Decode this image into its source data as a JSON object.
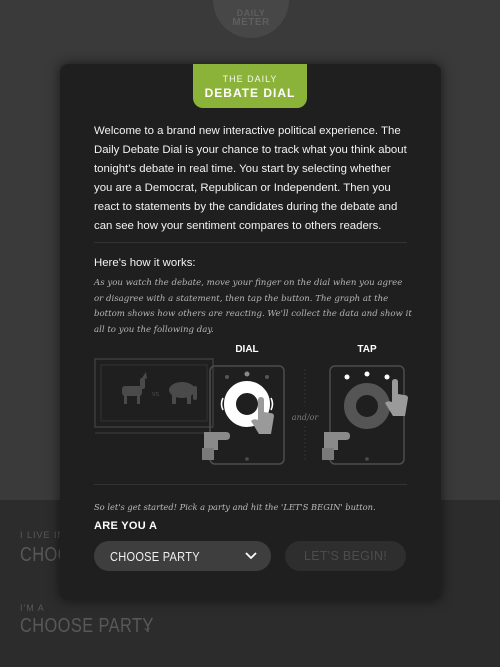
{
  "background": {
    "meter_line1": "DAILY",
    "meter_line2": "METER",
    "live_label": "I LIVE IN",
    "live_value": "CHOOSE",
    "party_label": "I'M A",
    "party_value": "CHOOSE PARTY"
  },
  "modal": {
    "badge_top": "THE DAILY",
    "badge_bottom": "DEBATE DIAL",
    "intro": "Welcome to a brand new interactive political experience. The Daily Debate Dial is your chance to track what you think about tonight's debate in real time. You start by selecting whether you are a Democrat, Republican or Independent. Then you react to statements by the candidates during the debate and can see how your sentiment compares to others readers.",
    "how_title": "Here's how it works:",
    "how_text": "As you watch the debate, move your finger on the dial when you agree or disagree with a statement, then tap the button. The graph at the bottom shows how others are reacting. We'll collect the data and show it all to you the following day.",
    "dial_label": "DIAL",
    "tap_label": "TAP",
    "andor_label": "and/or",
    "vs_label": "vs",
    "start_text": "So let's get started! Pick a party and hit the 'LET'S BEGIN' button.",
    "are_you": "ARE YOU A",
    "party_placeholder": "CHOOSE PARTY",
    "begin_button": "LET'S BEGIN!"
  },
  "colors": {
    "accent": "#8bb33a",
    "modal_bg": "#1f1f1f",
    "page_bg": "#3a3a3a"
  }
}
